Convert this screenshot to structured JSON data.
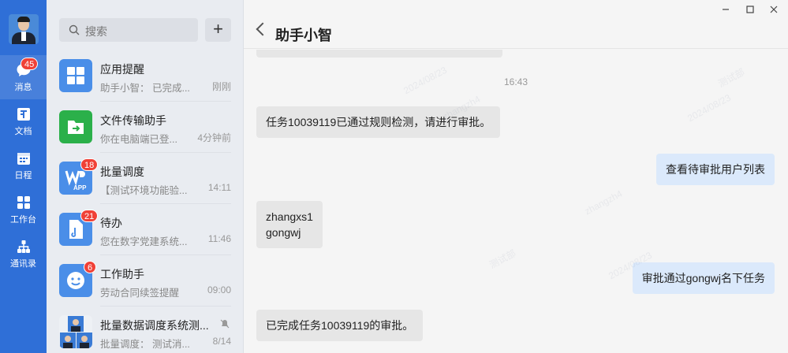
{
  "rail": {
    "items": [
      {
        "label": "消息",
        "badge": "45",
        "icon": "message-icon",
        "active": true
      },
      {
        "label": "文档",
        "icon": "document-icon"
      },
      {
        "label": "日程",
        "icon": "calendar-icon"
      },
      {
        "label": "工作台",
        "icon": "workbench-icon"
      },
      {
        "label": "通讯录",
        "icon": "contacts-icon"
      }
    ]
  },
  "search": {
    "placeholder": "搜索"
  },
  "conversations": [
    {
      "name": "应用提醒",
      "preview": "助手小智：  已完成...",
      "time": "刚刚",
      "icon": "app-grid-icon",
      "color": "#4a8ee8"
    },
    {
      "name": "文件传输助手",
      "preview": "你在电脑端已登...",
      "time": "4分钟前",
      "icon": "file-transfer-icon",
      "color": "#2bb04a"
    },
    {
      "name": "批量调度",
      "preview": "【测试环境功能验...",
      "time": "14:11",
      "badge": "18",
      "icon": "wps-app-icon",
      "color": "#4a8ee8",
      "app_label": "APP"
    },
    {
      "name": "待办",
      "preview": "您在数字党建系统...",
      "time": "11:46",
      "badge": "21",
      "icon": "todo-doc-icon",
      "color": "#4a8ee8"
    },
    {
      "name": "工作助手",
      "preview": "劳动合同续签提醒",
      "time": "09:00",
      "badge": "6",
      "icon": "smile-icon",
      "color": "#4a8ee8"
    },
    {
      "name": "批量数据调度系统测...",
      "preview": "批量调度：  测试消...",
      "time": "8/14",
      "icon": "group-avatar-icon",
      "color": "#6a8fc0",
      "muted": true
    }
  ],
  "chat": {
    "title": "助手小智",
    "timestamp": "16:43",
    "messages": [
      {
        "side": "in",
        "text": "任务10039119已通过规则检测，请进行审批。"
      },
      {
        "side": "out",
        "text": "查看待审批用户列表"
      },
      {
        "side": "in",
        "lines": [
          "zhangxs1",
          "gongwj"
        ]
      },
      {
        "side": "out",
        "text": "审批通过gongwj名下任务"
      },
      {
        "side": "in",
        "text": "已完成任务10039119的审批。"
      }
    ]
  },
  "watermark": {
    "texts": [
      "zhangzh4",
      "2024/08/23",
      "测试部"
    ]
  }
}
